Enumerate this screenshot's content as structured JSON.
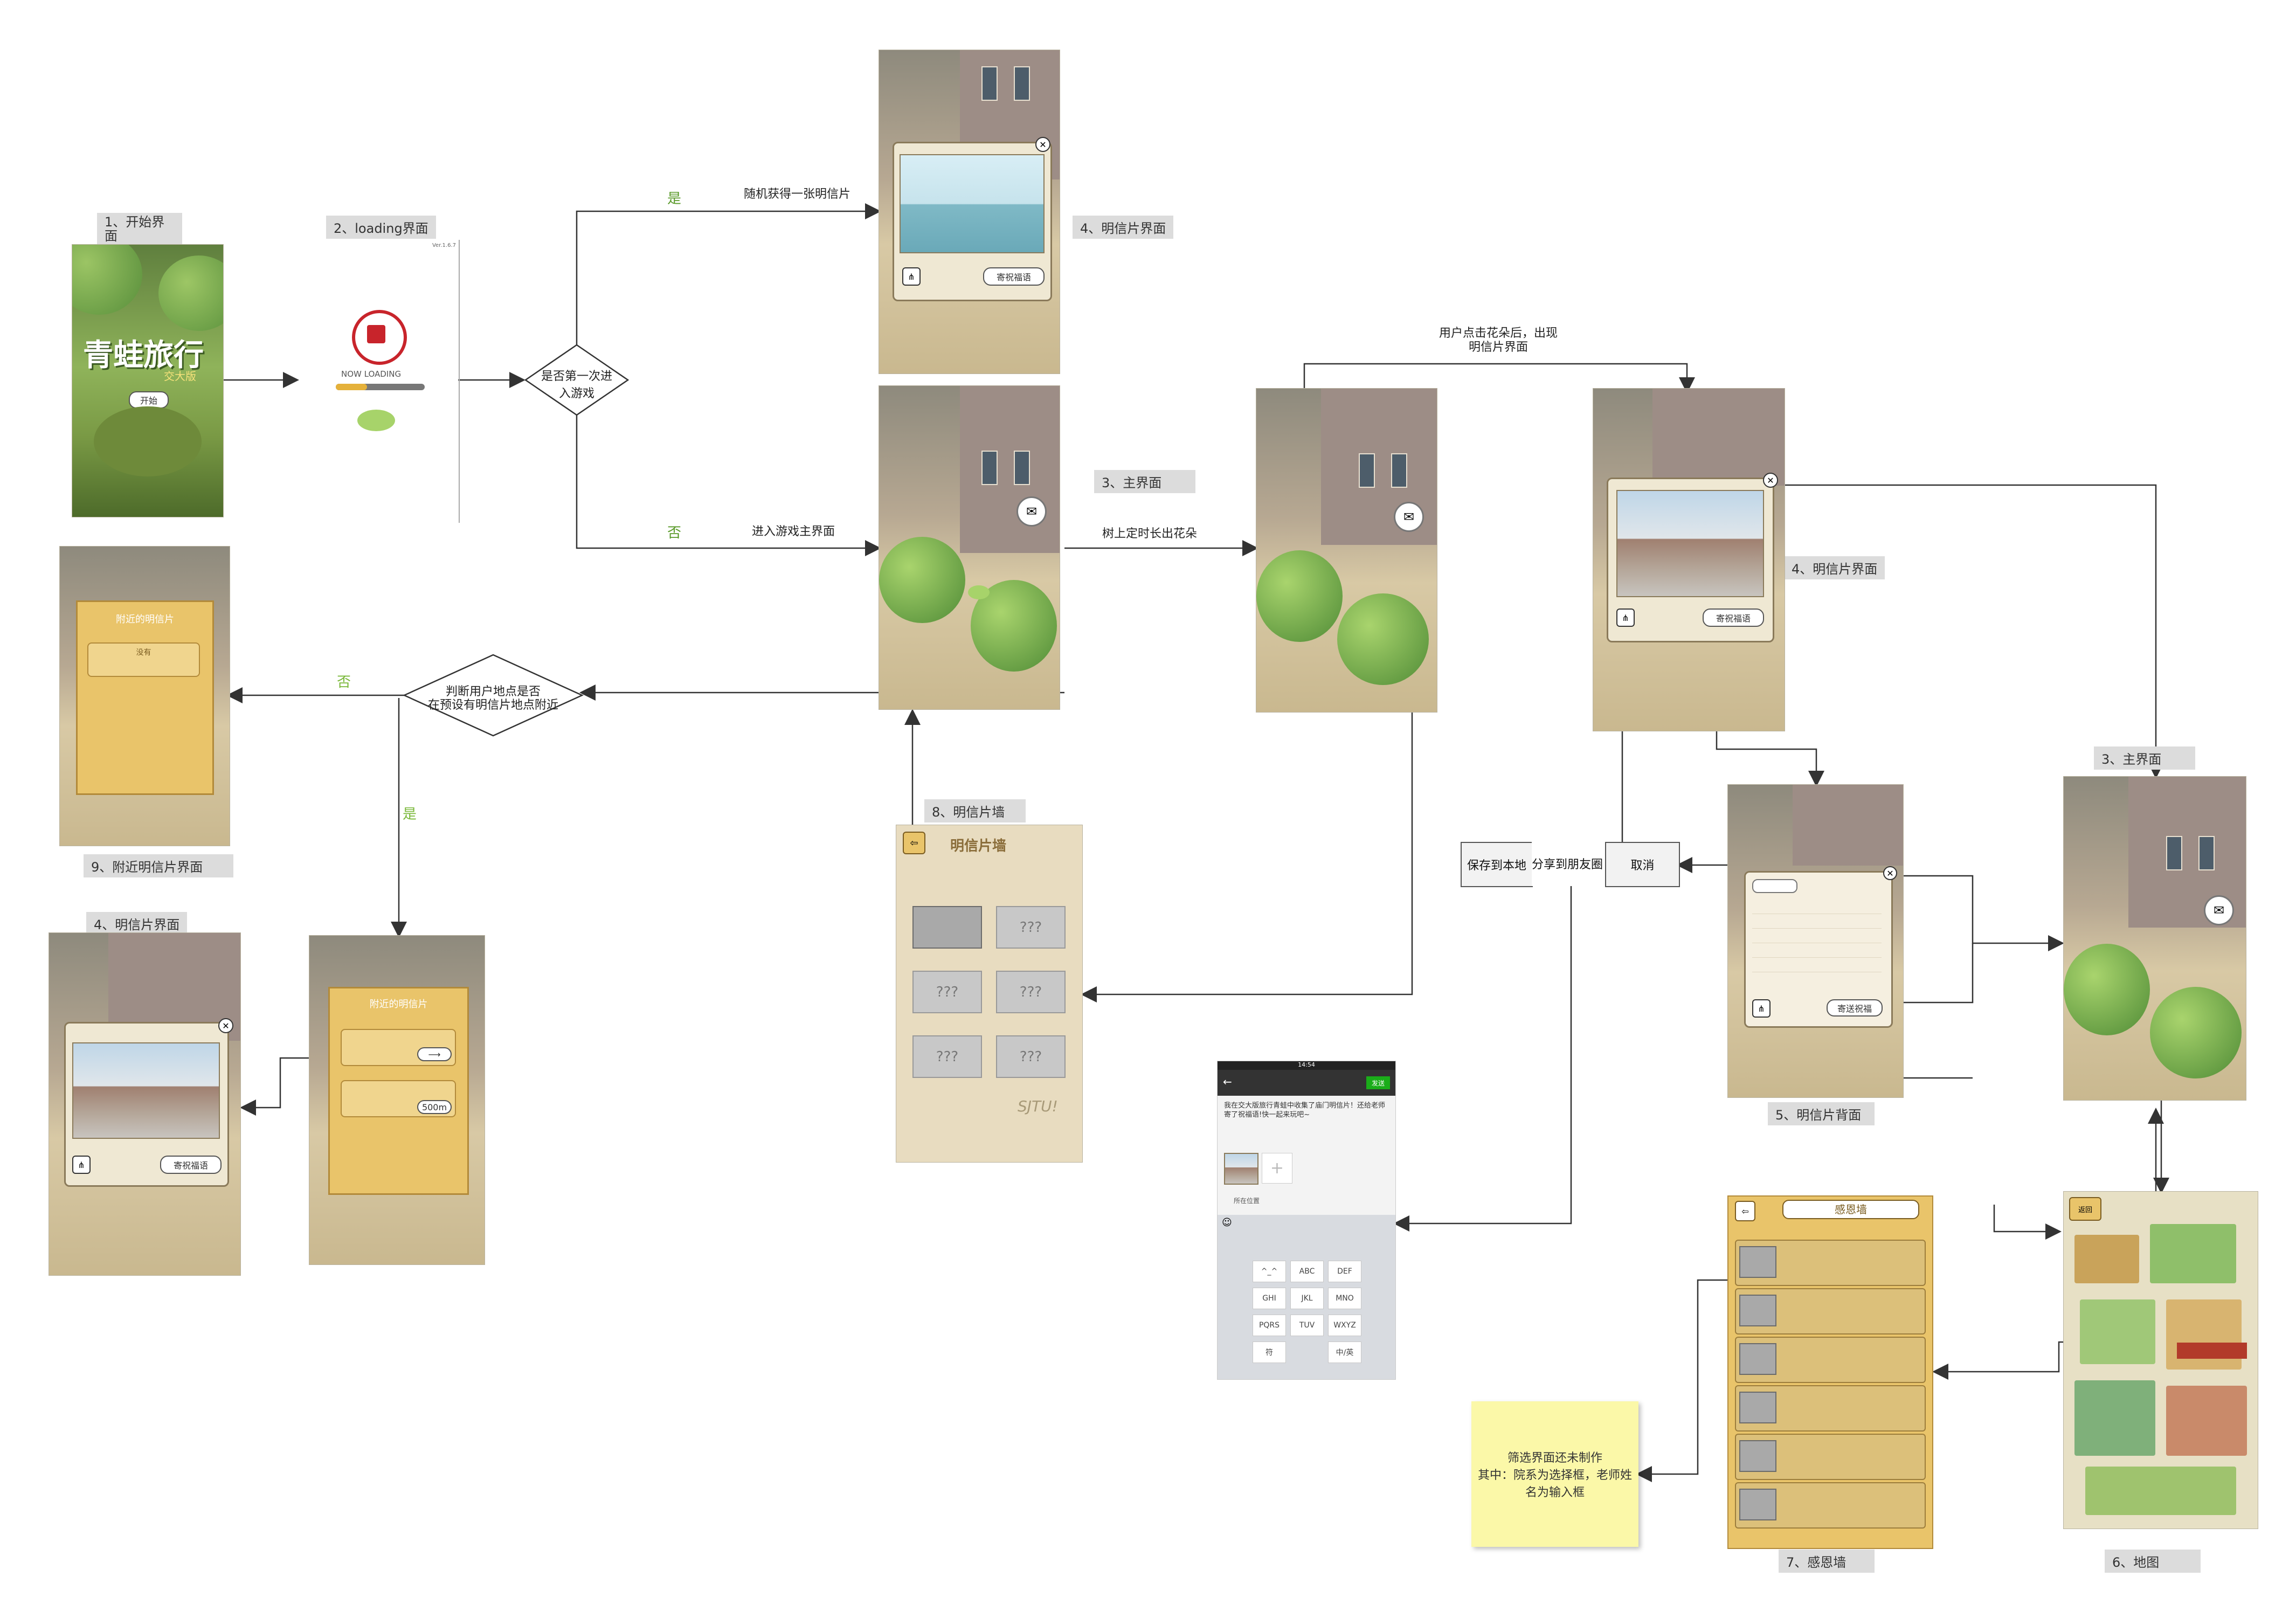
{
  "labels": {
    "s1": "1、开始界面",
    "s2": "2、loading界面",
    "s4a": "4、明信片界面",
    "s3a": "3、主界面",
    "s4b": "4、明信片界面",
    "s3b": "3、主界面",
    "s9": "9、附近明信片界面",
    "s4c": "4、明信片界面",
    "s8": "8、明信片墙",
    "s5": "5、明信片背面",
    "s7": "7、感恩墙",
    "s6": "6、地图"
  },
  "decisions": {
    "first_time": "是否第一次进入游戏",
    "location_line1": "判断用户地点是否",
    "location_line2": "在预设有明信片地点附近"
  },
  "edges": {
    "yes": "是",
    "no": "否",
    "random_postcard": "随机获得一张明信片",
    "enter_main": "进入游戏主界面",
    "tree_flowers": "树上定时长出花朵",
    "click_flower_line1": "用户点击花朵后，出现",
    "click_flower_line2": "明信片界面",
    "no2": "否",
    "yes2": "是"
  },
  "actions": {
    "save_local": "保存到本地",
    "share_moments": "分享到朋友圈",
    "cancel": "取消"
  },
  "note": {
    "line1": "筛选界面还未制作",
    "line2": "其中：院系为选择框，老师姓",
    "line3": "名为输入框"
  },
  "screens": {
    "start": {
      "title": "青蛙旅行",
      "subtitle": "交大版",
      "start_button": "开始"
    },
    "loading": {
      "text": "NOW LOADING",
      "version": "Ver.1.6.7"
    },
    "postcard": {
      "bless_button": "寄祝福语"
    },
    "wall": {
      "title": "明信片墙",
      "unknown": "???",
      "footer": "SJTU!"
    },
    "nearby": {
      "title": "附近的明信片",
      "distance": "500m"
    },
    "nearby_empty": {
      "title": "附近的明信片",
      "body": "没有"
    },
    "thanks": {
      "title": "感恩墙"
    },
    "back": {
      "send_button": "寄送祝福"
    },
    "share": {
      "time": "14:54",
      "send": "发送",
      "message": "我在交大版旅行青蛙中收集了庙门明信片！还给老师寄了祝福语!快一起来玩吧~",
      "location": "所在位置",
      "keys": [
        "^_^",
        "ABC",
        "DEF",
        "GHI",
        "JKL",
        "MNO",
        "PQRS",
        "TUV",
        "WXYZ",
        "符",
        "中/英"
      ]
    },
    "map": {
      "back": "返回"
    }
  }
}
